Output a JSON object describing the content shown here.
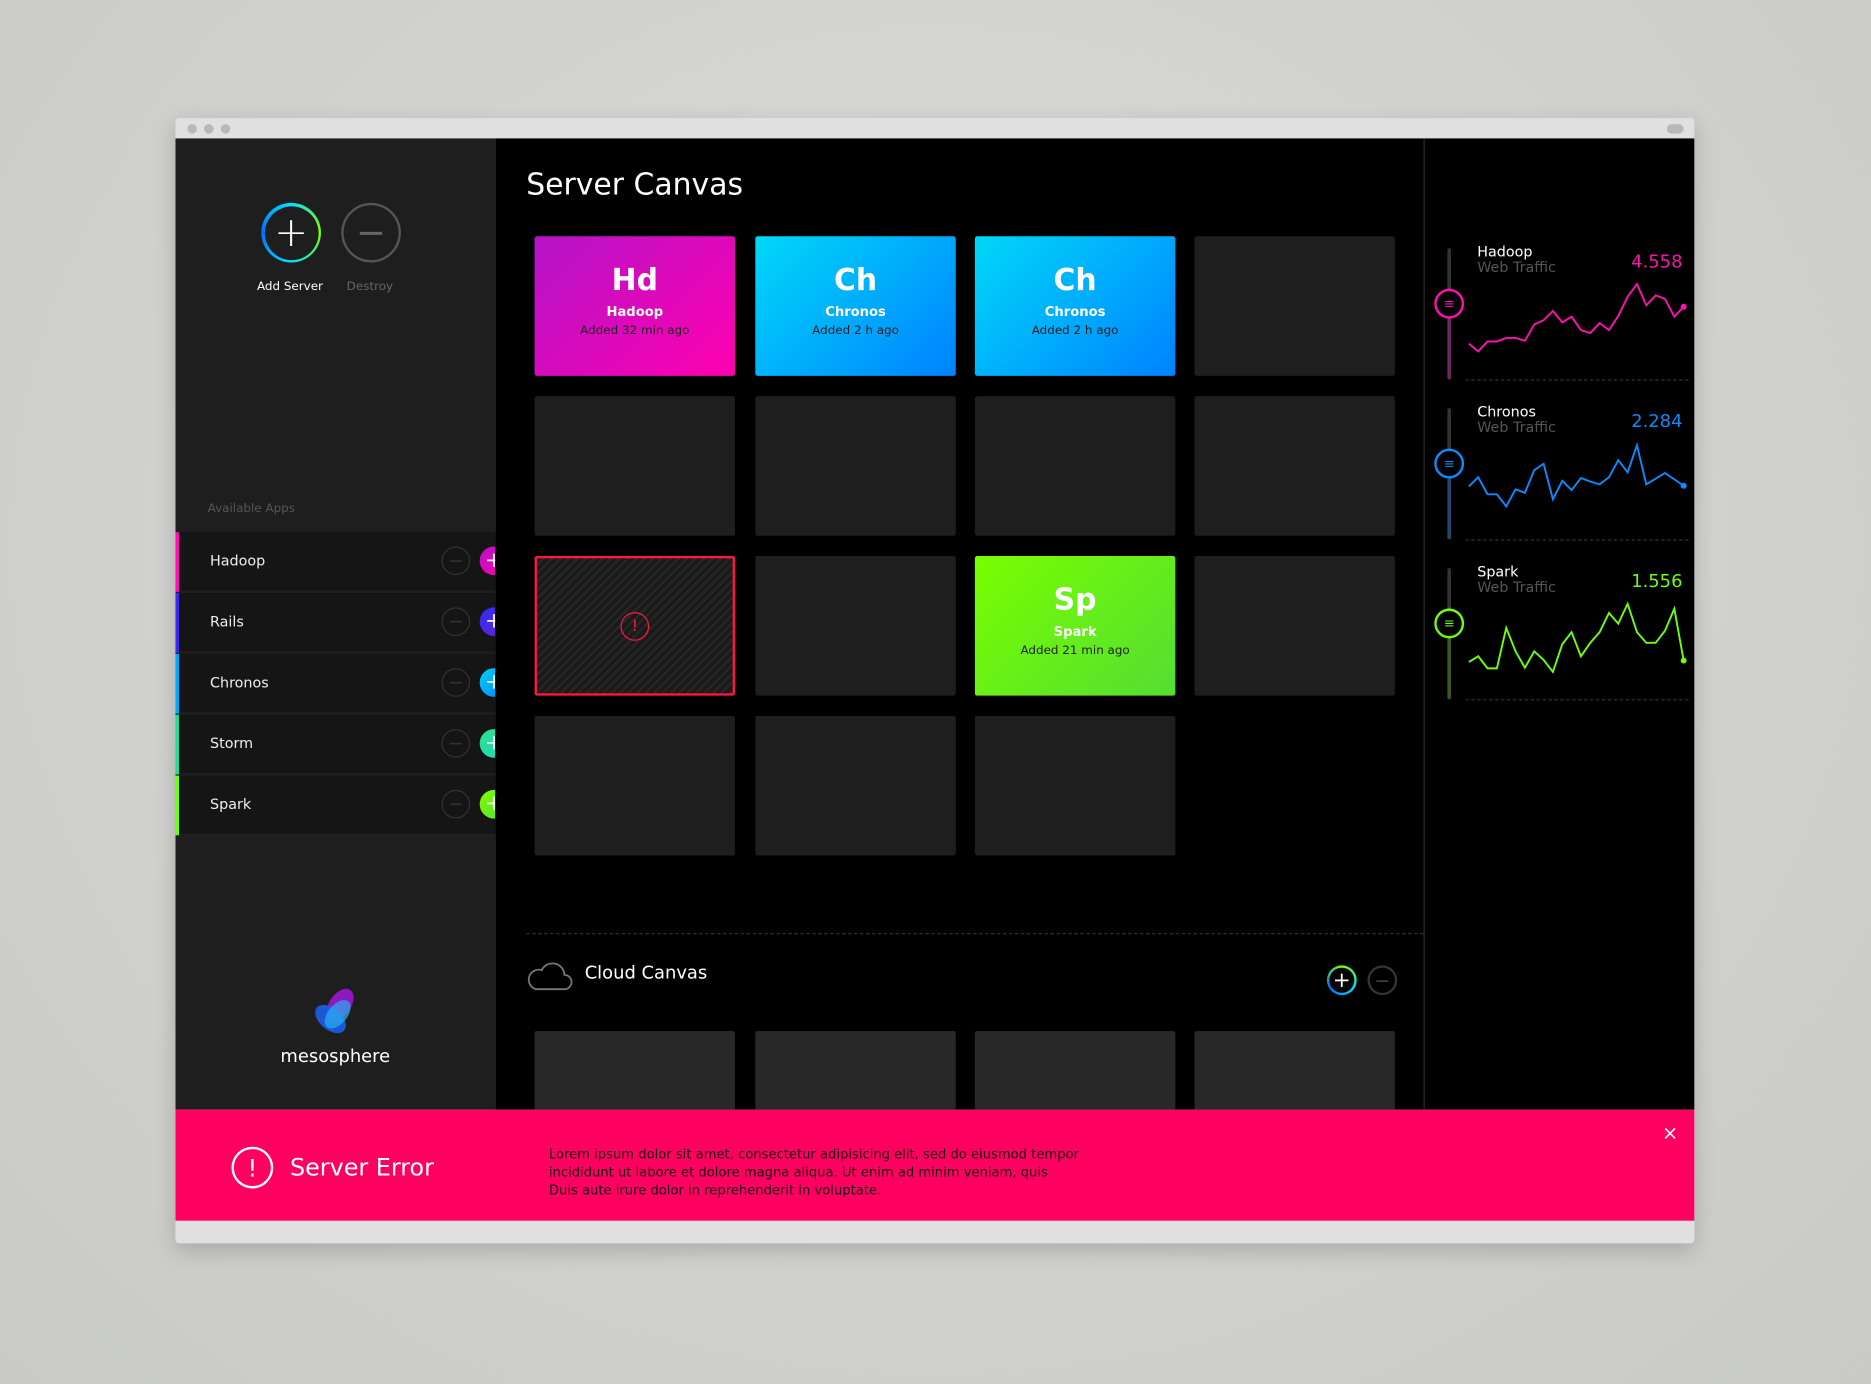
{
  "sidebar": {
    "add_label": "Add Server",
    "destroy_label": "Destroy",
    "section_title": "Available Apps",
    "apps": [
      {
        "name": "Hadoop",
        "color": "#ff10b0",
        "grad": [
          "#b414c8",
          "#ff00aa"
        ]
      },
      {
        "name": "Rails",
        "color": "#3a2bf0",
        "grad": [
          "#2a30f5",
          "#6a20d8"
        ]
      },
      {
        "name": "Chronos",
        "color": "#00a8ff",
        "grad": [
          "#00d2f5",
          "#0080ff"
        ]
      },
      {
        "name": "Storm",
        "color": "#22dd99",
        "grad": [
          "#33e08a",
          "#18d8c0"
        ]
      },
      {
        "name": "Spark",
        "color": "#6cff10",
        "grad": [
          "#7cff00",
          "#55dd33"
        ]
      }
    ],
    "logo_text": "mesosphere"
  },
  "main": {
    "title": "Server Canvas",
    "tiles": [
      {
        "abbr": "Hd",
        "name": "Hadoop",
        "time": "Added 32 min ago",
        "grad": [
          "#b414c8",
          "#ff00b0"
        ]
      },
      {
        "abbr": "Ch",
        "name": "Chronos",
        "time": "Added 2 h ago",
        "grad": [
          "#00d8f8",
          "#0082ff"
        ]
      },
      {
        "abbr": "Ch",
        "name": "Chronos",
        "time": "Added 2 h ago",
        "grad": [
          "#00d8f8",
          "#0082ff"
        ]
      },
      {
        "abbr": "Sp",
        "name": "Spark",
        "time": "Added 21 min ago",
        "grad": [
          "#78ff00",
          "#55dd33"
        ]
      }
    ],
    "error_tile_icon": "!",
    "cloud_title": "Cloud Canvas"
  },
  "traffic": [
    {
      "app": "Hadoop",
      "label": "Web Traffic",
      "value": "4.558",
      "color": "#ff10b0",
      "line": "#6a2a5a",
      "series": [
        16,
        5,
        19,
        19,
        24,
        24,
        20,
        43,
        49,
        62,
        46,
        54,
        35,
        31,
        45,
        35,
        55,
        82,
        100,
        70,
        84,
        79,
        54,
        68
      ]
    },
    {
      "app": "Chronos",
      "label": "Web Traffic",
      "value": "2.284",
      "color": "#0a8cff",
      "line": "#23466a",
      "series": [
        40,
        53,
        29,
        29,
        12,
        36,
        31,
        63,
        72,
        22,
        48,
        35,
        52,
        47,
        43,
        53,
        77,
        60,
        98,
        43,
        51,
        59,
        50,
        41
      ]
    },
    {
      "app": "Spark",
      "label": "Web Traffic",
      "value": "1.556",
      "color": "#6cff10",
      "line": "#3a5a22",
      "series": [
        18,
        26,
        9,
        9,
        66,
        33,
        10,
        33,
        21,
        4,
        43,
        60,
        26,
        45,
        60,
        87,
        72,
        100,
        60,
        45,
        45,
        62,
        93,
        20
      ]
    }
  ],
  "banner": {
    "title": "Server Error",
    "icon": "!",
    "close": "×",
    "color": "#ff0060",
    "lines": [
      "Lorem ipsum dolor sit amet, consectetur adipisicing elit, sed do eiusmod tempor",
      "incididunt ut labore et dolore magna aliqua. Ut enim ad minim veniam, quis",
      "Duis aute irure dolor in reprehenderit in voluptate."
    ]
  }
}
